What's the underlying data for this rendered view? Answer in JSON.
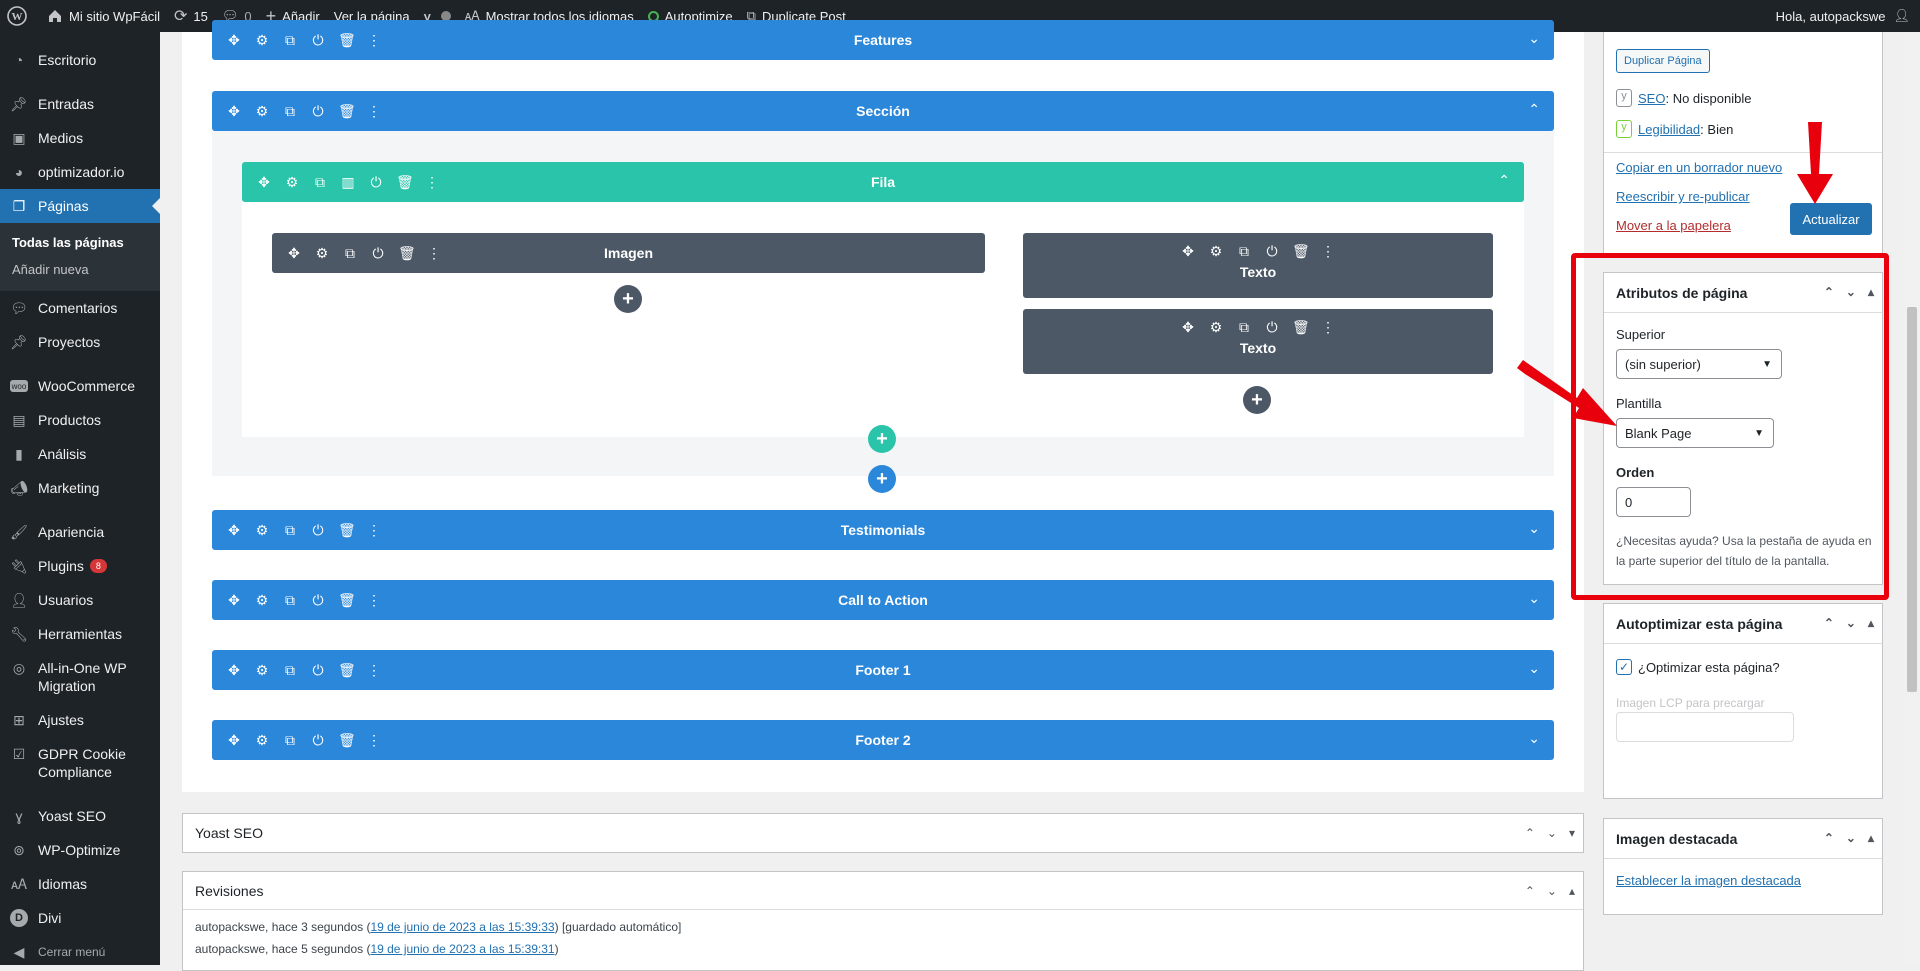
{
  "adminbar": {
    "site_name": "Mi sitio WpFácil",
    "updates": "15",
    "comments": "0",
    "add_new": "Añadir",
    "view_page": "Ver la página",
    "show_languages": "Mostrar todos los idiomas",
    "autoptimize": "Autoptimize",
    "duplicate_post": "Duplicate Post",
    "greeting": "Hola, autopackswe"
  },
  "sidebar": {
    "items": [
      {
        "label": "Escritorio",
        "icon": "dashboard-icon"
      },
      {
        "label": "Entradas",
        "icon": "pin-icon"
      },
      {
        "label": "Medios",
        "icon": "media-icon"
      },
      {
        "label": "optimizador.io",
        "icon": "gauge-icon"
      },
      {
        "label": "Páginas",
        "icon": "pages-icon"
      },
      {
        "label": "Comentarios",
        "icon": "comment-icon"
      },
      {
        "label": "Proyectos",
        "icon": "pin-icon"
      },
      {
        "label": "WooCommerce",
        "icon": "woo-icon"
      },
      {
        "label": "Productos",
        "icon": "archive-icon"
      },
      {
        "label": "Análisis",
        "icon": "chart-icon"
      },
      {
        "label": "Marketing",
        "icon": "megaphone-icon"
      },
      {
        "label": "Apariencia",
        "icon": "brush-icon"
      },
      {
        "label": "Plugins",
        "icon": "plug-icon",
        "badge": "8"
      },
      {
        "label": "Usuarios",
        "icon": "user-icon"
      },
      {
        "label": "Herramientas",
        "icon": "wrench-icon"
      },
      {
        "label": "All-in-One WP Migration",
        "icon": "migration-icon"
      },
      {
        "label": "Ajustes",
        "icon": "settings-icon"
      },
      {
        "label": "GDPR Cookie Compliance",
        "icon": "shield-icon"
      },
      {
        "label": "Yoast SEO",
        "icon": "yoast-icon"
      },
      {
        "label": "WP-Optimize",
        "icon": "optimize-icon"
      },
      {
        "label": "Idiomas",
        "icon": "language-icon"
      },
      {
        "label": "Divi",
        "icon": "divi-icon"
      },
      {
        "label": "Cerrar menú",
        "icon": "collapse-icon"
      }
    ],
    "submenu": [
      "Todas las páginas",
      "Añadir nueva"
    ]
  },
  "builder": {
    "sections": [
      "Features",
      "Sección",
      "Testimonials",
      "Call to Action",
      "Footer 1",
      "Footer 2"
    ],
    "row": "Fila",
    "modules": [
      "Imagen",
      "Texto",
      "Texto"
    ]
  },
  "publish": {
    "duplicate_button": "Duplicar Página",
    "seo_label": "SEO",
    "seo_value": ": No disponible",
    "readability_label": "Legibilidad",
    "readability_value": ": Bien",
    "copy_draft": "Copiar en un borrador nuevo",
    "rewrite": "Reescribir y re-publicar",
    "trash": "Mover a la papelera",
    "update_button": "Actualizar"
  },
  "attributes": {
    "title": "Atributos de página",
    "parent_label": "Superior",
    "parent_value": "(sin superior)",
    "template_label": "Plantilla",
    "template_value": "Blank Page",
    "order_label": "Orden",
    "order_value": "0",
    "help": "¿Necesitas ayuda? Usa la pestaña de ayuda en la parte superior del título de la pantalla."
  },
  "autoptimize_box": {
    "title": "Autoptimizar esta página",
    "checkbox_label": "¿Optimizar esta página?",
    "lcp_placeholder": "Imagen LCP para precargar"
  },
  "featured": {
    "title": "Imagen destacada",
    "link": "Establecer la imagen destacada"
  },
  "yoast_box": {
    "title": "Yoast SEO"
  },
  "revisions": {
    "title": "Revisiones",
    "items": [
      {
        "author": "autopackswe, hace 3 segundos (",
        "link": "19 de junio de 2023 a las 15:39:33",
        "suffix": ") [guardado automático]"
      },
      {
        "author": "autopackswe, hace 5 segundos (",
        "link": "19 de junio de 2023 a las 15:39:31",
        "suffix": ")"
      }
    ]
  },
  "colors": {
    "section": "#2b87da",
    "row": "#29c4a9",
    "module": "#4c5866",
    "highlight": "#e8000c",
    "wp_blue": "#2271b1"
  }
}
